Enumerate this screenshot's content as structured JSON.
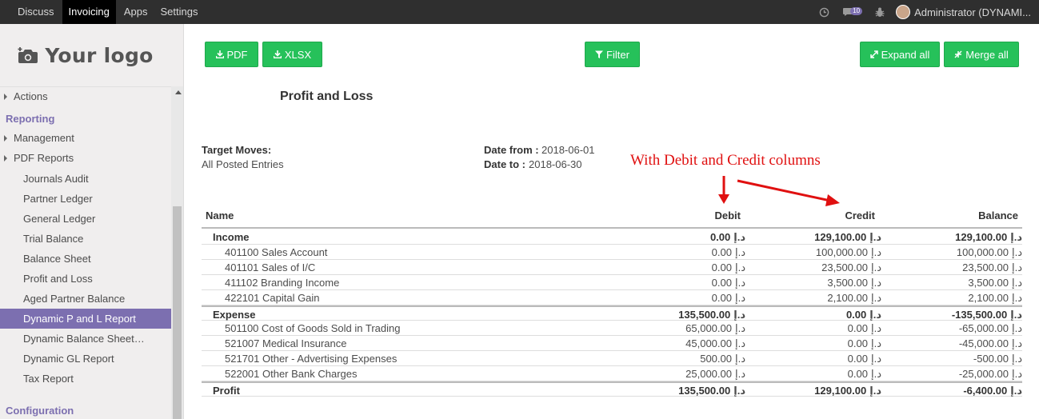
{
  "topbar": {
    "menu": [
      "Discuss",
      "Invoicing",
      "Apps",
      "Settings"
    ],
    "active_index": 1,
    "message_count": "10",
    "user": "Administrator (DYNAMI..."
  },
  "sidebar": {
    "logo_text": "Your logo",
    "items": [
      {
        "label": "Actions",
        "type": "lvl1-caret"
      },
      {
        "label": "Reporting",
        "type": "head"
      },
      {
        "label": "Management",
        "type": "lvl1-caret"
      },
      {
        "label": "PDF Reports",
        "type": "lvl1-caret"
      },
      {
        "label": "Journals Audit",
        "type": "lvl2"
      },
      {
        "label": "Partner Ledger",
        "type": "lvl2"
      },
      {
        "label": "General Ledger",
        "type": "lvl2"
      },
      {
        "label": "Trial Balance",
        "type": "lvl2"
      },
      {
        "label": "Balance Sheet",
        "type": "lvl2"
      },
      {
        "label": "Profit and Loss",
        "type": "lvl2"
      },
      {
        "label": "Aged Partner Balance",
        "type": "lvl2"
      },
      {
        "label": "Dynamic P and L Report",
        "type": "lvl2-active"
      },
      {
        "label": "Dynamic Balance Sheet…",
        "type": "lvl2"
      },
      {
        "label": "Dynamic GL Report",
        "type": "lvl2"
      },
      {
        "label": "Tax Report",
        "type": "lvl2"
      },
      {
        "label": "Configuration",
        "type": "head"
      }
    ]
  },
  "toolbar": {
    "pdf": "PDF",
    "xlsx": "XLSX",
    "filter": "Filter",
    "expand_all": "Expand all",
    "merge_all": "Merge all"
  },
  "report": {
    "title": "Profit and Loss",
    "target_moves_label": "Target Moves:",
    "target_moves_value": "All Posted Entries",
    "date_from_label": "Date from :",
    "date_from_value": "2018-06-01",
    "date_to_label": "Date to :",
    "date_to_value": "2018-06-30",
    "annotation": "With Debit and Credit columns",
    "currency_symbol": "د.إ",
    "columns": {
      "name": "Name",
      "debit": "Debit",
      "credit": "Credit",
      "balance": "Balance"
    },
    "rows": [
      {
        "name": "Income",
        "debit": "0.00",
        "credit": "129,100.00",
        "balance": "129,100.00",
        "group": true
      },
      {
        "name": "401100 Sales Account",
        "debit": "0.00",
        "credit": "100,000.00",
        "balance": "100,000.00",
        "group": false
      },
      {
        "name": "401101 Sales of I/C",
        "debit": "0.00",
        "credit": "23,500.00",
        "balance": "23,500.00",
        "group": false
      },
      {
        "name": "411102 Branding Income",
        "debit": "0.00",
        "credit": "3,500.00",
        "balance": "3,500.00",
        "group": false
      },
      {
        "name": "422101 Capital Gain",
        "debit": "0.00",
        "credit": "2,100.00",
        "balance": "2,100.00",
        "group": false
      },
      {
        "name": "Expense",
        "debit": "135,500.00",
        "credit": "0.00",
        "balance": "-135,500.00",
        "group": true
      },
      {
        "name": "501100 Cost of Goods Sold in Trading",
        "debit": "65,000.00",
        "credit": "0.00",
        "balance": "-65,000.00",
        "group": false
      },
      {
        "name": "521007 Medical Insurance",
        "debit": "45,000.00",
        "credit": "0.00",
        "balance": "-45,000.00",
        "group": false
      },
      {
        "name": "521701 Other - Advertising Expenses",
        "debit": "500.00",
        "credit": "0.00",
        "balance": "-500.00",
        "group": false
      },
      {
        "name": "522001 Other Bank Charges",
        "debit": "25,000.00",
        "credit": "0.00",
        "balance": "-25,000.00",
        "group": false
      },
      {
        "name": "Profit",
        "debit": "135,500.00",
        "credit": "129,100.00",
        "balance": "-6,400.00",
        "group": true
      }
    ]
  },
  "colors": {
    "accent": "#7c6fb0",
    "button": "#26c15a",
    "annotation": "#e01010",
    "topbar": "#2f2f2f"
  }
}
